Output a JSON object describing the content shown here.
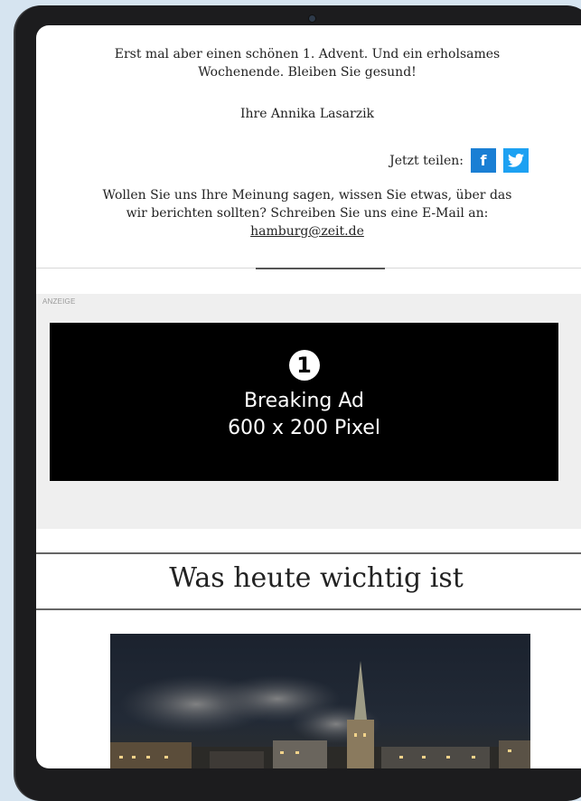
{
  "email": {
    "greeting": "Erst mal aber einen schönen 1. Advent. Und ein erholsames Wochenende. Bleiben Sie gesund!",
    "signature": "Ihre Annika Lasarzik",
    "share": {
      "label": "Jetzt teilen:",
      "facebook_icon": "f",
      "twitter_icon": "twitter-bird-icon"
    },
    "feedback_text": "Wollen Sie uns Ihre Meinung sagen, wissen Sie etwas, über das wir berichten sollten? Schreiben Sie uns eine E-Mail an:",
    "feedback_email": "hamburg@zeit.de"
  },
  "ad": {
    "label": "ANZEIGE",
    "number": "1",
    "title": "Breaking Ad",
    "size": "600 x 200 Pixel"
  },
  "section": {
    "headline": "Was heute wichtig ist"
  },
  "colors": {
    "facebook": "#1a7fd4",
    "twitter": "#1da1f2",
    "ad_background": "#000000",
    "ad_area": "#efefef"
  }
}
